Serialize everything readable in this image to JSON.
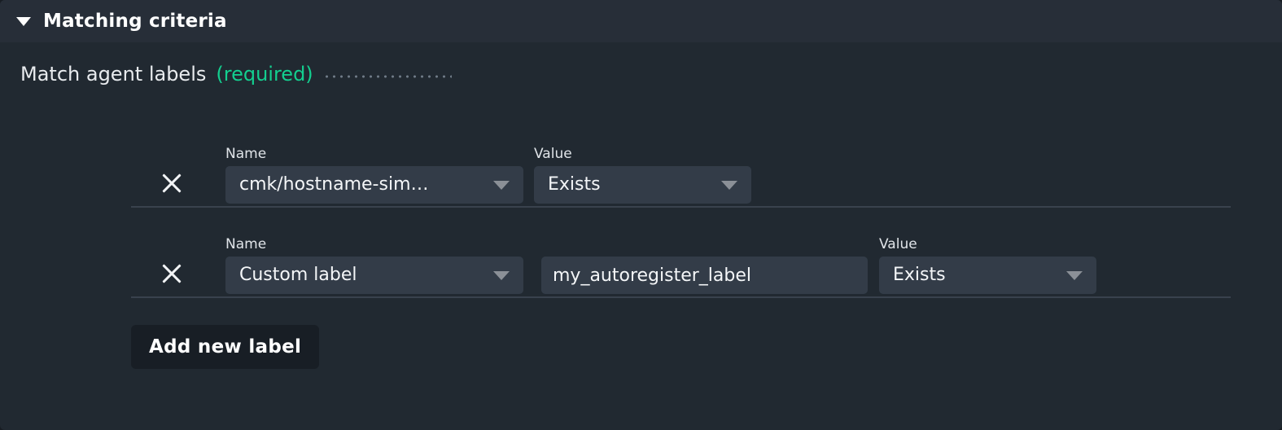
{
  "panel": {
    "title": "Matching criteria",
    "collapse_icon": "caret-down-icon",
    "expanded": true
  },
  "field": {
    "label": "Match agent labels",
    "required_text": "(required)",
    "leader": "...................."
  },
  "colors": {
    "panel_background": "#212931",
    "header_background": "#272e38",
    "input_background": "#333c48",
    "accent_required": "#13cf8f",
    "text_primary": "#f4f6f8",
    "separator": "#39424d",
    "button_background": "#181e25",
    "arrow_gray": "#8b9097"
  },
  "rows": [
    {
      "delete_icon": "close-x-icon",
      "name": {
        "caption": "Name",
        "value": "cmk/hostname-sim…",
        "arrow_icon": "caret-down-icon"
      },
      "text": null,
      "value": {
        "caption": "Value",
        "value": "Exists",
        "arrow_icon": "caret-down-icon"
      }
    },
    {
      "delete_icon": "close-x-icon",
      "name": {
        "caption": "Name",
        "value": "Custom label",
        "arrow_icon": "caret-down-icon"
      },
      "text": {
        "value": "my_autoregister_label",
        "placeholder": ""
      },
      "value": {
        "caption": "Value",
        "value": "Exists",
        "arrow_icon": "caret-down-icon"
      }
    }
  ],
  "add_button": {
    "label": "Add new label"
  }
}
